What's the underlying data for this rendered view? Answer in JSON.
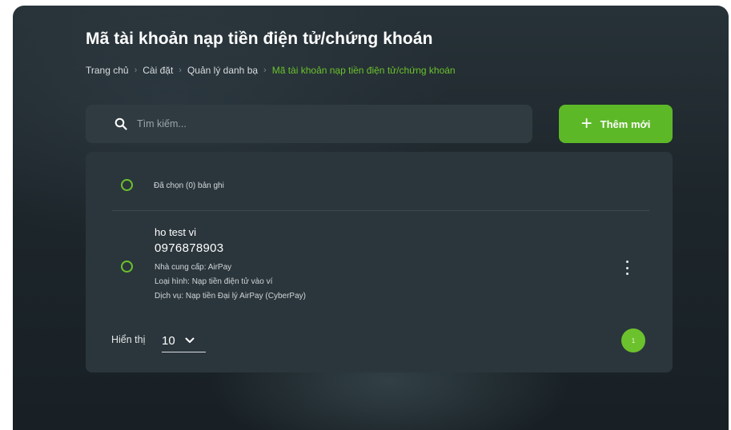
{
  "page": {
    "title": "Mã tài khoản nạp tiền điện tử/chứng khoán"
  },
  "breadcrumb": [
    "Trang chủ",
    "Cài đặt",
    "Quản lý danh bạ",
    "Mã tài khoản nạp tiền điện tử/chứng khoán"
  ],
  "breadcrumb_separator": "›",
  "search": {
    "placeholder": "Tìm kiếm..."
  },
  "add_button": {
    "icon": "+",
    "label": "Thêm mới"
  },
  "selection": {
    "label": "Đã chọn (0) bản ghi"
  },
  "items": [
    {
      "name": "ho test vi",
      "number": "0976878903",
      "provider": "Nhà cung cấp: AirPay",
      "type": "Loại hình: Nạp tiền điện tử vào ví",
      "service": "Dịch vụ: Nạp tiền Đại lý AirPay (CyberPay)"
    }
  ],
  "pagination": {
    "show_label": "Hiển thị",
    "page_size": "10",
    "current_page": "1"
  },
  "colors": {
    "accent": "#6cc22c",
    "button": "#5db828",
    "panel": "#2b363c",
    "background": "#1d262b"
  },
  "icons": {
    "search": "search-icon",
    "add": "plus-icon",
    "more": "more-vertical-icon",
    "dropdown": "chevron-down-icon"
  }
}
